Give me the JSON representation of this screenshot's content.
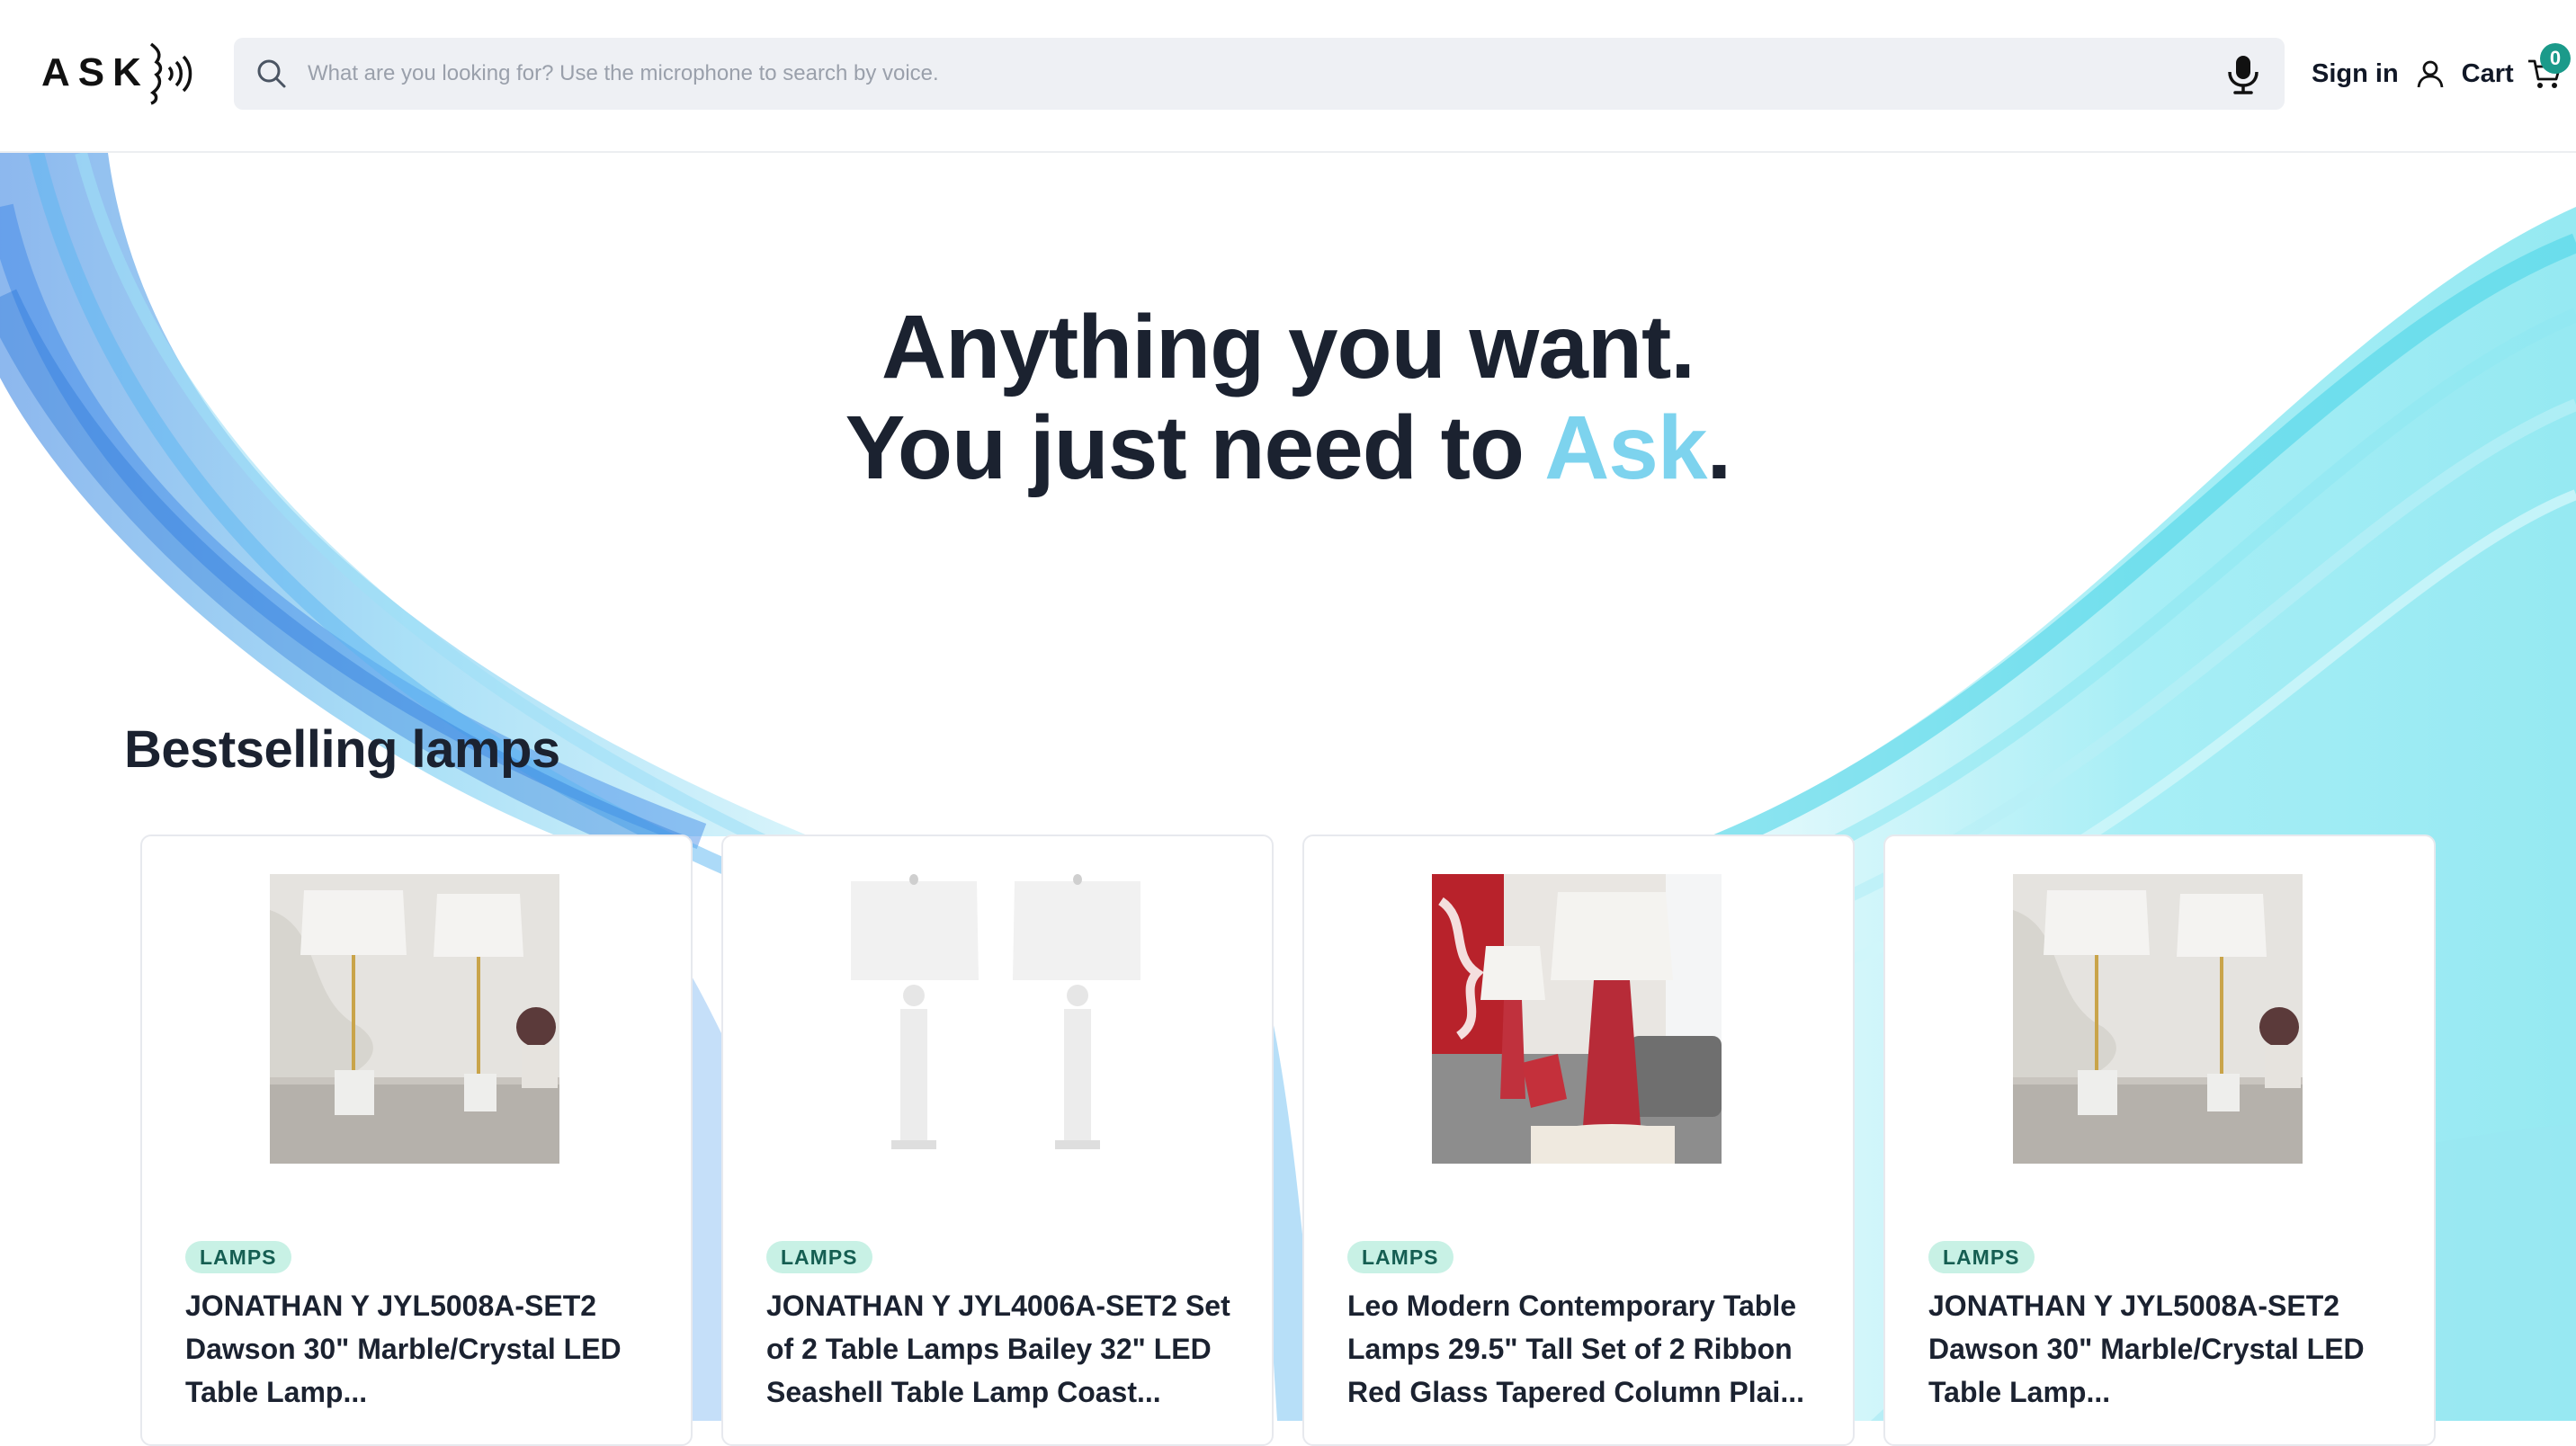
{
  "header": {
    "logo_text": "ASK",
    "search_placeholder": "What are you looking for? Use the microphone to search by voice.",
    "sign_in_label": "Sign in",
    "cart_label": "Cart",
    "cart_count": "0"
  },
  "hero": {
    "line1": "Anything you want.",
    "line2_prefix": "You just need to ",
    "line2_highlight": "Ask",
    "line2_suffix": "."
  },
  "section": {
    "title": "Bestselling lamps"
  },
  "products": [
    {
      "category": "LAMPS",
      "title": "JONATHAN Y JYL5008A-SET2 Dawson 30\" Marble/Crystal LED Table Lamp..."
    },
    {
      "category": "LAMPS",
      "title": "JONATHAN Y JYL4006A-SET2 Set of 2 Table Lamps Bailey 32\" LED Seashell Table Lamp Coast..."
    },
    {
      "category": "LAMPS",
      "title": "Leo Modern Contemporary Table Lamps 29.5\" Tall Set of 2 Ribbon Red Glass Tapered Column Plai..."
    },
    {
      "category": "LAMPS",
      "title": "JONATHAN Y JYL5008A-SET2 Dawson 30\" Marble/Crystal LED Table Lamp..."
    }
  ],
  "colors": {
    "accent": "#7dd3ee",
    "badge_bg": "#c8f1e5",
    "badge_text": "#155e52",
    "cart_badge": "#1b9a8a",
    "heading": "#1b2230"
  },
  "icons": [
    "search-icon",
    "microphone-icon",
    "user-icon",
    "cart-icon",
    "sound-waves-icon"
  ]
}
